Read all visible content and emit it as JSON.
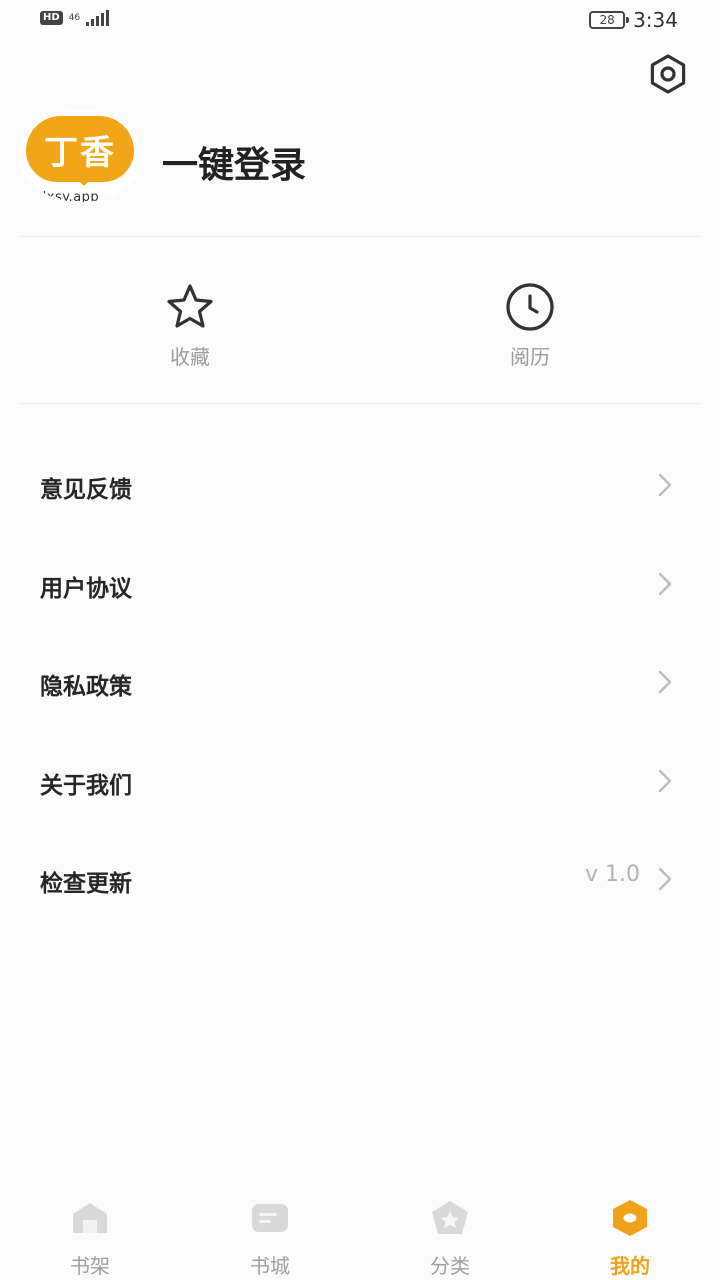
{
  "status_bar": {
    "hd_badge": "HD",
    "network": "46",
    "battery": "28",
    "time": "3:34"
  },
  "profile": {
    "logo_text": "丁香",
    "logo_url": "dxsy.app",
    "login_label": "一键登录"
  },
  "quick_actions": [
    {
      "label": "收藏",
      "icon": "star-icon"
    },
    {
      "label": "阅历",
      "icon": "clock-icon"
    }
  ],
  "menu": [
    {
      "label": "意见反馈",
      "value": ""
    },
    {
      "label": "用户协议",
      "value": ""
    },
    {
      "label": "隐私政策",
      "value": ""
    },
    {
      "label": "关于我们",
      "value": ""
    },
    {
      "label": "检查更新",
      "value": "v 1.0"
    }
  ],
  "bottom_nav": {
    "active_index": 3,
    "active_color": "#f0a21a",
    "inactive_color": "#a0a0a0",
    "items": [
      {
        "label": "书架",
        "icon": "bookshelf-icon"
      },
      {
        "label": "书城",
        "icon": "bookstore-icon"
      },
      {
        "label": "分类",
        "icon": "category-icon"
      },
      {
        "label": "我的",
        "icon": "profile-icon"
      }
    ]
  },
  "colors": {
    "background": "#fbfbfb",
    "brand_orange": "#f2a516"
  }
}
